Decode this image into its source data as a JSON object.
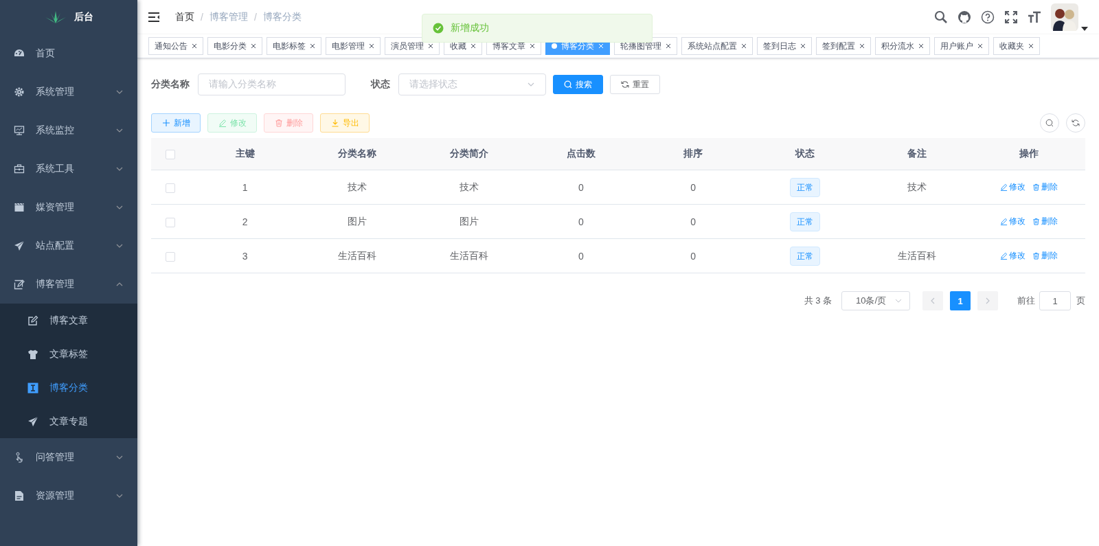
{
  "sidebar": {
    "logo_text": "后台",
    "items": [
      {
        "label": "首页",
        "selected": false
      },
      {
        "label": "系统管理",
        "selected": false,
        "expanded": false
      },
      {
        "label": "系统监控",
        "selected": false,
        "expanded": false
      },
      {
        "label": "系统工具",
        "selected": false,
        "expanded": false
      },
      {
        "label": "媒资管理",
        "selected": false,
        "expanded": false
      },
      {
        "label": "站点配置",
        "selected": false,
        "expanded": false
      },
      {
        "label": "博客管理",
        "selected": false,
        "expanded": true,
        "children": [
          {
            "label": "博客文章",
            "selected": false
          },
          {
            "label": "文章标签",
            "selected": false
          },
          {
            "label": "博客分类",
            "selected": true
          },
          {
            "label": "文章专题",
            "selected": false
          }
        ]
      },
      {
        "label": "问答管理",
        "selected": false,
        "expanded": false
      },
      {
        "label": "资源管理",
        "selected": false,
        "expanded": false
      }
    ]
  },
  "header": {
    "breadcrumb": [
      "首页",
      "博客管理",
      "博客分类"
    ],
    "separators": [
      "/",
      "/"
    ]
  },
  "tags": [
    {
      "label": "通知公告",
      "selected": false
    },
    {
      "label": "电影分类",
      "selected": false
    },
    {
      "label": "电影标签",
      "selected": false
    },
    {
      "label": "电影管理",
      "selected": false
    },
    {
      "label": "演员管理",
      "selected": false
    },
    {
      "label": "收藏",
      "selected": false
    },
    {
      "label": "博客文章",
      "selected": false
    },
    {
      "label": "博客分类",
      "selected": true
    },
    {
      "label": "轮播图管理",
      "selected": false
    },
    {
      "label": "系统站点配置",
      "selected": false
    },
    {
      "label": "签到日志",
      "selected": false
    },
    {
      "label": "签到配置",
      "selected": false
    },
    {
      "label": "积分流水",
      "selected": false
    },
    {
      "label": "用户账户",
      "selected": false
    },
    {
      "label": "收藏夹",
      "selected": false
    }
  ],
  "toast": {
    "text": "新增成功"
  },
  "filters": [
    {
      "kind": "input",
      "label": "分类名称",
      "placeholder": "请输入分类名称"
    },
    {
      "kind": "select",
      "label": "状态",
      "placeholder": "请选择状态"
    }
  ],
  "filter_buttons": [
    {
      "kind": "search",
      "label": "搜索"
    },
    {
      "kind": "reset",
      "label": "重置"
    }
  ],
  "toolbar": [
    {
      "kind": "add",
      "label": "新增",
      "disabled": false
    },
    {
      "kind": "edit",
      "label": "修改",
      "disabled": true
    },
    {
      "kind": "delete",
      "label": "删除",
      "disabled": true
    },
    {
      "kind": "export",
      "label": "导出",
      "disabled": false
    }
  ],
  "table": {
    "select_all_checked": false,
    "columns": [
      "主键",
      "分类名称",
      "分类简介",
      "点击数",
      "排序",
      "状态",
      "备注",
      "操作"
    ],
    "rows": [
      {
        "checked": false,
        "cells": [
          "1",
          "技术",
          "技术",
          "0",
          "0"
        ],
        "status": "正常",
        "remark": "技术",
        "actions": [
          "修改",
          "删除"
        ]
      },
      {
        "checked": false,
        "cells": [
          "2",
          "图片",
          "图片",
          "0",
          "0"
        ],
        "status": "正常",
        "actions": [
          "修改",
          "删除"
        ]
      },
      {
        "checked": false,
        "cells": [
          "3",
          "生活百科",
          "生活百科",
          "0",
          "0"
        ],
        "status": "正常",
        "remark": "生活百科",
        "actions": [
          "修改",
          "删除"
        ]
      }
    ]
  },
  "pagination": {
    "total": "共 3 条",
    "page_size": "10条/页",
    "pages": [
      {
        "label": "1",
        "selected": true
      }
    ],
    "goto_label": "前往",
    "goto_value": "1",
    "page_suffix": "页"
  }
}
